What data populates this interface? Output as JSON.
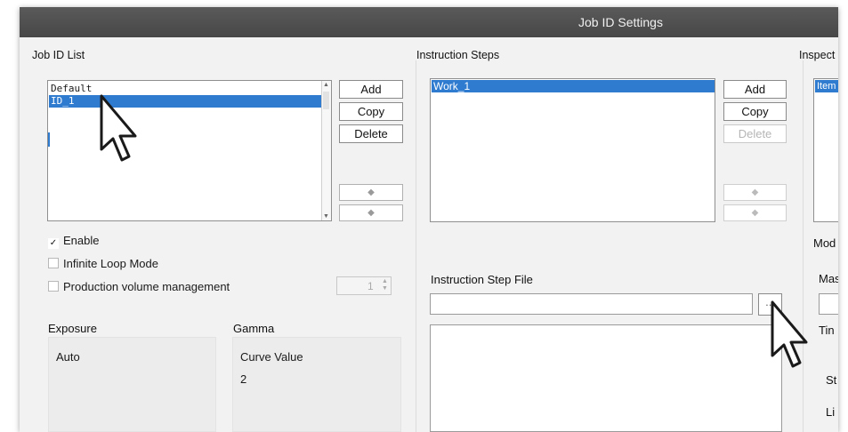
{
  "window": {
    "title": "Job ID Settings"
  },
  "job_id_list": {
    "label": "Job ID List",
    "items": [
      "Default",
      "ID_1"
    ],
    "selected_index": 1,
    "buttons": {
      "add": "Add",
      "copy": "Copy",
      "delete": "Delete",
      "up": "◆",
      "down": "◆"
    }
  },
  "options": {
    "enable": {
      "label": "Enable",
      "checked": true
    },
    "infinite_loop": {
      "label": "Infinite Loop Mode",
      "checked": false
    },
    "production_volume": {
      "label": "Production volume management",
      "checked": false,
      "value": "1"
    }
  },
  "exposure": {
    "label": "Exposure",
    "value": "Auto"
  },
  "gamma": {
    "label": "Gamma",
    "curve_label": "Curve Value",
    "curve_value": "2"
  },
  "instruction_steps": {
    "label": "Instruction Steps",
    "items": [
      "Work_1"
    ],
    "selected_index": 0,
    "buttons": {
      "add": "Add",
      "copy": "Copy",
      "delete": "Delete",
      "up": "◆",
      "down": "◆"
    }
  },
  "instruction_step_file": {
    "label": "Instruction Step File",
    "value": "",
    "browse_label": "..."
  },
  "inspection": {
    "label": "Inspect",
    "list_item": "Item",
    "mode_label": "Mod",
    "mas_label": "Mas",
    "tin_label": "Tin",
    "st_label": "St",
    "li_label": "Li"
  }
}
